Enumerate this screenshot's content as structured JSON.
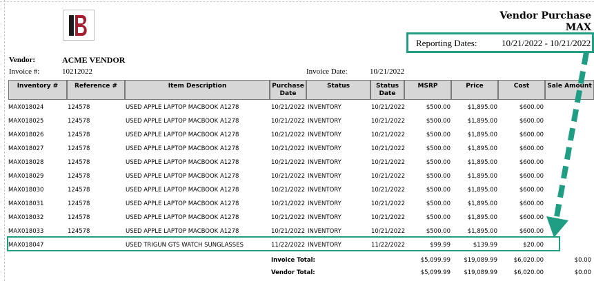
{
  "report": {
    "title_line1": "Vendor Purchase",
    "title_line2": "MAX",
    "reporting_dates_label": "Reporting Dates:",
    "reporting_dates_value": "10/21/2022 - 10/21/2022"
  },
  "vendor": {
    "label": "Vendor:",
    "name": "ACME VENDOR",
    "invoice_label": "Invoice #:",
    "invoice_number": "10212022",
    "invoice_date_label": "Invoice Date:",
    "invoice_date": "10/21/2022"
  },
  "table": {
    "headers": [
      "Inventory #",
      "Reference #",
      "Item Description",
      "Purchase Date",
      "Status",
      "Status Date",
      "MSRP",
      "Price",
      "Cost",
      "Sale Amount"
    ],
    "rows": [
      [
        "MAX018024",
        "124578",
        "USED APPLE LAPTOP MACBOOK A1278",
        "10/21/2022",
        "INVENTORY",
        "10/21/2022",
        "$500.00",
        "$1,895.00",
        "$600.00",
        ""
      ],
      [
        "MAX018025",
        "124578",
        "USED APPLE LAPTOP MACBOOK A1278",
        "10/21/2022",
        "INVENTORY",
        "10/21/2022",
        "$500.00",
        "$1,895.00",
        "$600.00",
        ""
      ],
      [
        "MAX018026",
        "124578",
        "USED APPLE LAPTOP MACBOOK A1278",
        "10/21/2022",
        "INVENTORY",
        "10/21/2022",
        "$500.00",
        "$1,895.00",
        "$600.00",
        ""
      ],
      [
        "MAX018027",
        "124578",
        "USED APPLE LAPTOP MACBOOK A1278",
        "10/21/2022",
        "INVENTORY",
        "10/21/2022",
        "$500.00",
        "$1,895.00",
        "$600.00",
        ""
      ],
      [
        "MAX018028",
        "124578",
        "USED APPLE LAPTOP MACBOOK A1278",
        "10/21/2022",
        "INVENTORY",
        "10/21/2022",
        "$500.00",
        "$1,895.00",
        "$600.00",
        ""
      ],
      [
        "MAX018029",
        "124578",
        "USED APPLE LAPTOP MACBOOK A1278",
        "10/21/2022",
        "INVENTORY",
        "10/21/2022",
        "$500.00",
        "$1,895.00",
        "$600.00",
        ""
      ],
      [
        "MAX018030",
        "124578",
        "USED APPLE LAPTOP MACBOOK A1278",
        "10/21/2022",
        "INVENTORY",
        "10/21/2022",
        "$500.00",
        "$1,895.00",
        "$600.00",
        ""
      ],
      [
        "MAX018031",
        "124578",
        "USED APPLE LAPTOP MACBOOK A1278",
        "10/21/2022",
        "INVENTORY",
        "10/21/2022",
        "$500.00",
        "$1,895.00",
        "$600.00",
        ""
      ],
      [
        "MAX018032",
        "124578",
        "USED APPLE LAPTOP MACBOOK A1278",
        "10/21/2022",
        "INVENTORY",
        "10/21/2022",
        "$500.00",
        "$1,895.00",
        "$600.00",
        ""
      ],
      [
        "MAX018033",
        "124578",
        "USED APPLE LAPTOP MACBOOK A1278",
        "10/21/2022",
        "INVENTORY",
        "10/21/2022",
        "$500.00",
        "$1,895.00",
        "$600.00",
        ""
      ],
      [
        "MAX018047",
        "",
        "USED TRIGUN GTS WATCH SUNGLASSES",
        "11/22/2022",
        "INVENTORY",
        "11/22/2022",
        "$99.99",
        "$139.99",
        "$20.00",
        ""
      ]
    ]
  },
  "totals": {
    "invoice_total_label": "Invoice Total:",
    "invoice_msrp": "$5,099.99",
    "invoice_price": "$19,089.99",
    "invoice_cost": "$6,020.00",
    "invoice_sale": "$0.00",
    "vendor_total_label": "Vendor Total:",
    "vendor_msrp": "$5,099.99",
    "vendor_price": "$19,089.99",
    "vendor_cost": "$6,020.00",
    "vendor_sale": "$0.00"
  },
  "colors": {
    "highlight": "#1f9e84",
    "header_bg": "#d6d6d6",
    "logo_red": "#a31f2e"
  }
}
